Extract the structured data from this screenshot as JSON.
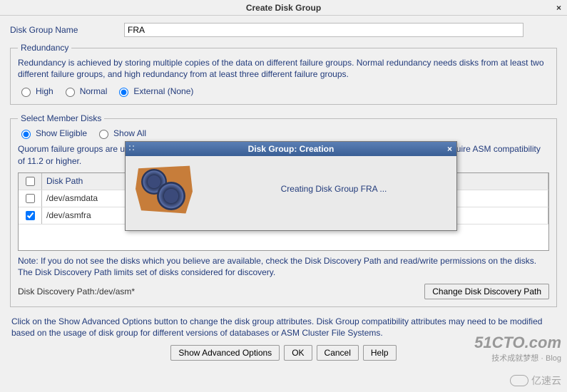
{
  "window": {
    "title": "Create Disk Group",
    "close_glyph": "×"
  },
  "form": {
    "disk_group_name_label": "Disk Group Name",
    "disk_group_name_value": "FRA"
  },
  "redundancy": {
    "legend": "Redundancy",
    "desc": "Redundancy is achieved by storing multiple copies of the data on different failure groups. Normal redundancy needs disks from at least two different failure groups, and high redundancy from at least three different failure groups.",
    "options": {
      "high": "High",
      "normal": "Normal",
      "external": "External (None)"
    },
    "selected": "external"
  },
  "members": {
    "legend": "Select Member Disks",
    "filter": {
      "eligible": "Show Eligible",
      "all": "Show All",
      "selected": "eligible"
    },
    "quorum_note": "Quorum failure groups are used to store voting files in extended clusters and do not contain any user data. They require ASM compatibility of 11.2 or higher.",
    "columns": {
      "disk_path": "Disk Path"
    },
    "rows": [
      {
        "checked": false,
        "disk_path": "/dev/asmdata"
      },
      {
        "checked": true,
        "disk_path": "/dev/asmfra"
      }
    ],
    "note": "Note: If you do not see the disks which you believe are available, check the Disk Discovery Path and read/write permissions on the disks. The Disk Discovery Path limits set of disks considered for discovery.",
    "discovery_path_label": "Disk Discovery Path:",
    "discovery_path_value": "/dev/asm*",
    "change_path_button": "Change Disk Discovery Path"
  },
  "advanced_desc": "Click on the Show Advanced Options button to change the disk group attributes. Disk Group compatibility attributes may need to be modified based on the usage of disk group for different versions of databases or ASM Cluster File Systems.",
  "buttons": {
    "advanced": "Show Advanced Options",
    "ok": "OK",
    "cancel": "Cancel",
    "help": "Help"
  },
  "modal": {
    "title": "Disk Group: Creation",
    "close_glyph": "×",
    "message": "Creating Disk Group FRA ..."
  },
  "watermark": {
    "main": "51CTO.com",
    "sub": "技术成就梦想 · Blog",
    "alt": "亿速云"
  }
}
